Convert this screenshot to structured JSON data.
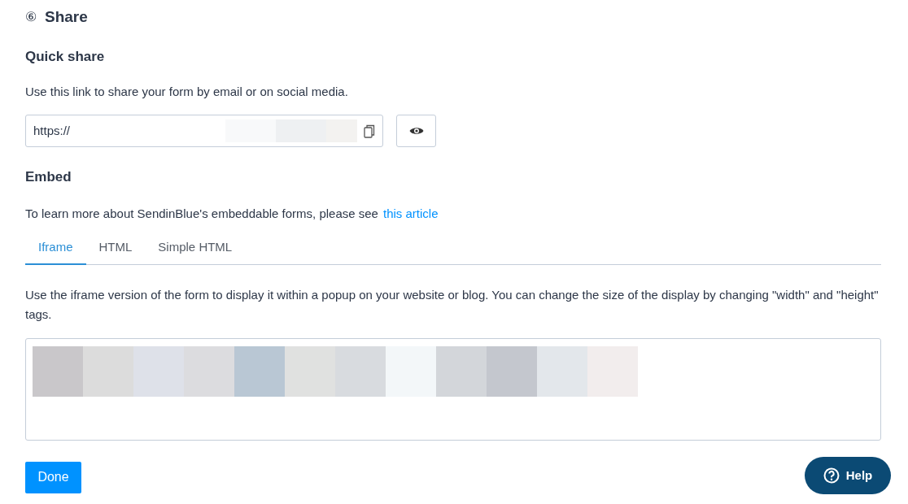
{
  "section": {
    "number": "⑥",
    "title": "Share"
  },
  "quick_share": {
    "heading": "Quick share",
    "description": "Use this link to share your form by email or on social media.",
    "link_value": "https://"
  },
  "embed": {
    "heading": "Embed",
    "intro": "To learn more about SendinBlue's embeddable forms, please see",
    "link": "this article",
    "tabs": [
      {
        "label": "Iframe",
        "selected": true
      },
      {
        "label": "HTML",
        "selected": false
      },
      {
        "label": "Simple HTML",
        "selected": false
      }
    ],
    "instructions": "Use the iframe version of the form to display it within a popup on your website or blog. You can change the size of the display by changing \"width\" and \"height\" tags."
  },
  "buttons": {
    "done": "Done",
    "help": "Help"
  }
}
